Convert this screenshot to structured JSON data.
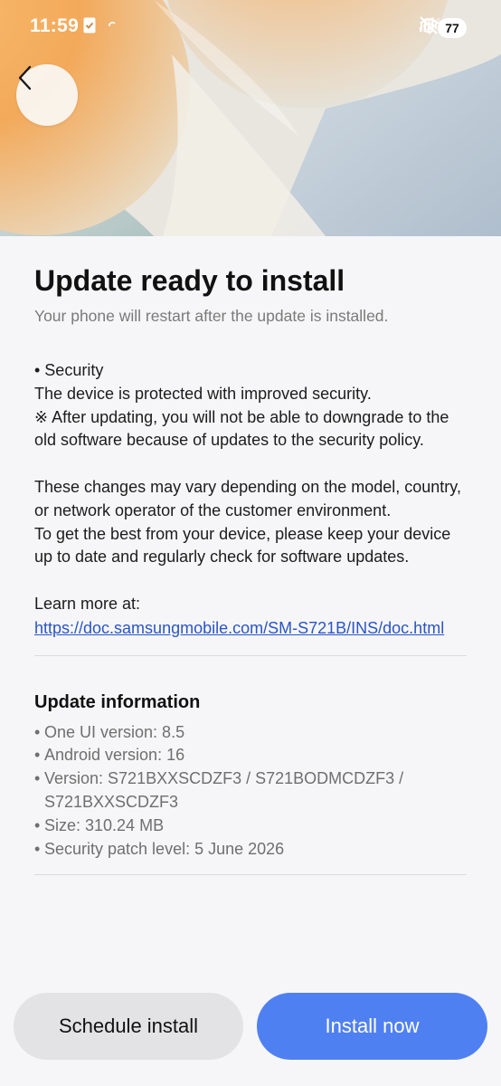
{
  "status_bar": {
    "time": "11:59",
    "battery": "77",
    "icons": [
      "task-check-icon",
      "sync-dot-icon",
      "vibrate-mute-icon",
      "wifi-icon",
      "signal-icon"
    ]
  },
  "header": {
    "back_icon": "chevron-left-icon"
  },
  "main": {
    "title": "Update ready to install",
    "subtitle": "Your phone will restart after the update is installed.",
    "body_lines": [
      "• Security",
      "The device is protected with improved security.",
      "※ After updating, you will not be able to downgrade to the old software because of updates to the security policy."
    ],
    "body_lines_2": [
      "These changes may vary depending on the model, country, or network operator of the customer environment.",
      "To get the best from your device, please keep your device up to date and regularly check for software updates."
    ],
    "learn_more_label": "Learn more at:",
    "learn_more_link": "https://doc.samsungmobile.com/SM-S721B/INS/doc.html"
  },
  "update_info": {
    "heading": "Update information",
    "items": [
      "One UI version: 8.5",
      "Android version: 16",
      "Version: S721BXXSCDZF3 / S721BODMCDZF3 / S721BXXSCDZF3",
      "Size: 310.24 MB",
      "Security patch level: 5 June 2026"
    ]
  },
  "buttons": {
    "schedule_label": "Schedule install",
    "install_label": "Install now"
  },
  "colors": {
    "accent": "#4f80f2",
    "link": "#2a55c4",
    "secondary_button": "#e3e3e5",
    "background": "#f6f6f8"
  }
}
